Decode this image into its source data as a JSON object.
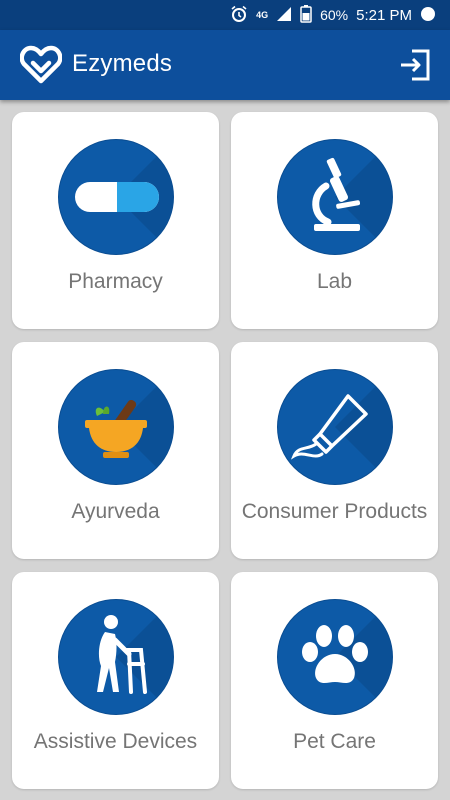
{
  "status_bar": {
    "network": "4G",
    "battery": "60%",
    "time": "5:21 PM",
    "icons": [
      "alarm-icon",
      "signal-icon",
      "battery-icon",
      "record-icon"
    ]
  },
  "app_bar": {
    "title": "Ezymeds",
    "logo_icon": "heart-logo-icon",
    "action_icon": "exit-icon"
  },
  "categories": [
    {
      "label": "Pharmacy",
      "icon": "pill-icon"
    },
    {
      "label": "Lab",
      "icon": "microscope-icon"
    },
    {
      "label": "Ayurveda",
      "icon": "mortar-icon"
    },
    {
      "label": "Consumer Products",
      "icon": "tube-icon"
    },
    {
      "label": "Assistive Devices",
      "icon": "walker-icon"
    },
    {
      "label": "Pet Care",
      "icon": "paw-icon"
    }
  ],
  "colors": {
    "primary": "#0d4f9c",
    "status_bar": "#0a3f7d",
    "icon_circle": "#0d5aa7",
    "background": "#d4d4d4",
    "label": "#757575",
    "pill_blue": "#2aa5e6",
    "ayurveda_orange": "#f5a623",
    "ayurveda_green": "#6bbf3a"
  }
}
